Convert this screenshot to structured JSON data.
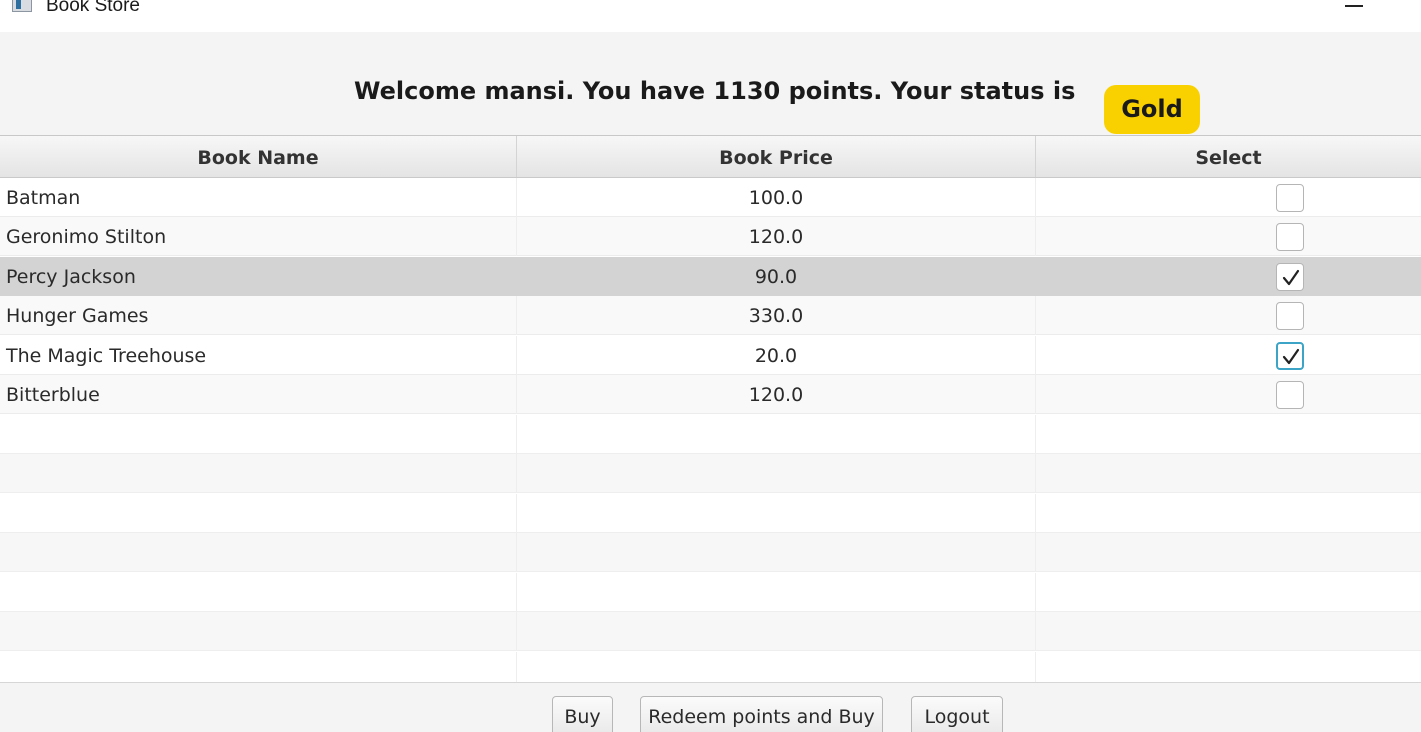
{
  "window": {
    "title": "Book Store"
  },
  "header": {
    "welcome_text": "Welcome mansi. You have 1130 points. Your status is",
    "status": "Gold",
    "status_color": "#f9d100"
  },
  "table": {
    "columns": [
      "Book Name",
      "Book Price",
      "Select"
    ],
    "rows": [
      {
        "name": "Batman",
        "price": "100.0",
        "checked": false,
        "selected": false,
        "focused": false
      },
      {
        "name": "Geronimo Stilton",
        "price": "120.0",
        "checked": false,
        "selected": false,
        "focused": false
      },
      {
        "name": "Percy Jackson",
        "price": "90.0",
        "checked": true,
        "selected": true,
        "focused": false
      },
      {
        "name": "Hunger Games",
        "price": "330.0",
        "checked": false,
        "selected": false,
        "focused": false
      },
      {
        "name": "The Magic Treehouse",
        "price": "20.0",
        "checked": true,
        "selected": false,
        "focused": true
      },
      {
        "name": "Bitterblue",
        "price": "120.0",
        "checked": false,
        "selected": false,
        "focused": false
      }
    ]
  },
  "footer": {
    "buy_label": "Buy",
    "redeem_label": "Redeem points and Buy",
    "logout_label": "Logout"
  }
}
